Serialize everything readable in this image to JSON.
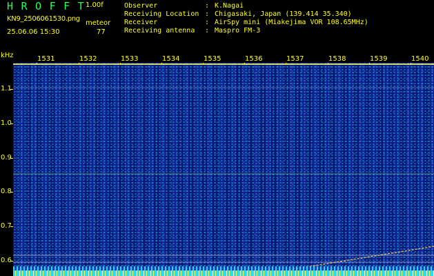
{
  "header": {
    "app_title": "HROFFT",
    "version": "1.00f",
    "filename": "KN9_2506061530.png",
    "mode_label": "meteor",
    "datetime": "25.06.06 15:30",
    "count": "77",
    "metadata": [
      {
        "key": "Observer",
        "sep": ":",
        "value": "K.Nagai"
      },
      {
        "key": "Receiving Location",
        "sep": ":",
        "value": "Chigasaki, Japan (139.414 35.340)"
      },
      {
        "key": "Receiver",
        "sep": ":",
        "value": "AirSpy mini (Miakejima VOR 108.65MHz)"
      },
      {
        "key": "Receiving antenna",
        "sep": ":",
        "value": "Maspro FM-3"
      }
    ]
  },
  "spectrogram": {
    "y_unit": "kHz",
    "y_ticks": [
      "1.1",
      "1.0",
      "0.9",
      "0.8",
      "0.7",
      "0.6"
    ],
    "x_ticks": [
      "1531",
      "1532",
      "1533",
      "1534",
      "1535",
      "1536",
      "1537",
      "1538",
      "1539",
      "1540"
    ],
    "colors": {
      "background": "#0d1a8a",
      "noise": "#28c8e6",
      "label": "#ffff22",
      "title": "#22ff55"
    }
  }
}
